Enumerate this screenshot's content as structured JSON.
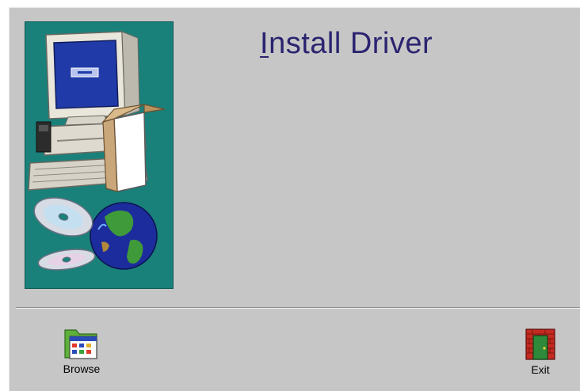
{
  "dialog": {
    "title_mnemonic": "I",
    "title_rest": "nstall Driver"
  },
  "toolbar": {
    "browse_label": "Browse",
    "exit_label": "Exit"
  },
  "icons": {
    "browse": "folder-calendar-icon",
    "exit": "brick-door-exit-icon"
  },
  "colors": {
    "background": "#c6c6c6",
    "panel": "#1a807a",
    "title": "#2b2470"
  }
}
